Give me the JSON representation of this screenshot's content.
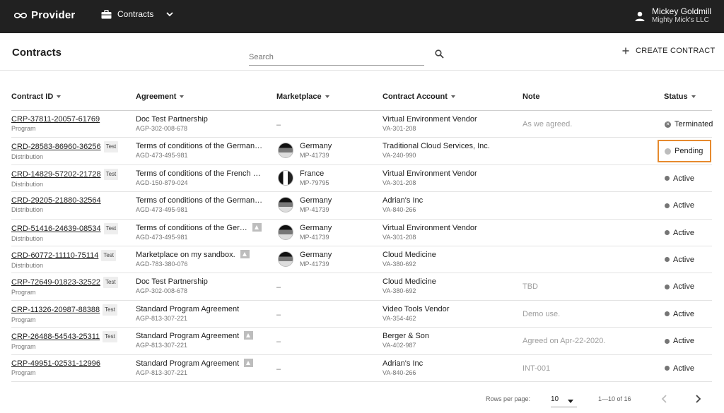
{
  "app": {
    "name": "Provider",
    "product": "Contracts"
  },
  "user": {
    "name": "Mickey Goldmill",
    "org": "Mighty Mick's LLC"
  },
  "page": {
    "title": "Contracts",
    "search_placeholder": "Search",
    "create_label": "CREATE CONTRACT"
  },
  "table": {
    "columns": {
      "contract_id": "Contract ID",
      "agreement": "Agreement",
      "marketplace": "Marketplace",
      "account": "Contract Account",
      "note": "Note",
      "status": "Status"
    },
    "rows": [
      {
        "id": "CRP-37811-20057-61769",
        "type": "Program",
        "test": "",
        "agreement": "Doc Test Partnership",
        "agreement_id": "AGP-302-008-678",
        "warn": false,
        "marketplace": "",
        "marketplace_id": "",
        "flag": "",
        "empty": "–",
        "account": "Virtual Environment Vendor",
        "account_id": "VA-301-208",
        "note": "As we agreed.",
        "status": "Terminated",
        "status_icon": "terminated-icon"
      },
      {
        "id": "CRD-28583-86960-36256",
        "type": "Distribution",
        "test": "Test",
        "agreement": "Terms of conditions of the German…",
        "agreement_id": "AGD-473-495-981",
        "warn": false,
        "marketplace": "Germany",
        "marketplace_id": "MP-41739",
        "flag": "de",
        "empty": "",
        "account": "Traditional Cloud Services, Inc.",
        "account_id": "VA-240-990",
        "note": "",
        "status": "Pending",
        "status_icon": "pending-icon",
        "highlight": true
      },
      {
        "id": "CRD-14829-57202-21728",
        "type": "Distribution",
        "test": "Test",
        "agreement": "Terms of conditions of the French …",
        "agreement_id": "AGD-150-879-024",
        "warn": false,
        "marketplace": "France",
        "marketplace_id": "MP-79795",
        "flag": "fr",
        "empty": "",
        "account": "Virtual Environment Vendor",
        "account_id": "VA-301-208",
        "note": "",
        "status": "Active",
        "status_icon": "active-icon"
      },
      {
        "id": "CRD-29205-21880-32564",
        "type": "Distribution",
        "test": "",
        "agreement": "Terms of conditions of the German…",
        "agreement_id": "AGD-473-495-981",
        "warn": false,
        "marketplace": "Germany",
        "marketplace_id": "MP-41739",
        "flag": "de",
        "empty": "",
        "account": "Adrian's Inc",
        "account_id": "VA-840-266",
        "note": "",
        "status": "Active",
        "status_icon": "active-icon"
      },
      {
        "id": "CRD-51416-24639-08534",
        "type": "Distribution",
        "test": "Test",
        "agreement": "Terms of conditions of the Ger…",
        "agreement_id": "AGD-473-495-981",
        "warn": true,
        "marketplace": "Germany",
        "marketplace_id": "MP-41739",
        "flag": "de",
        "empty": "",
        "account": "Virtual Environment Vendor",
        "account_id": "VA-301-208",
        "note": "",
        "status": "Active",
        "status_icon": "active-icon"
      },
      {
        "id": "CRD-60772-11110-75114",
        "type": "Distribution",
        "test": "Test",
        "agreement": "Marketplace on my sandbox.",
        "agreement_id": "AGD-783-380-076",
        "warn": true,
        "marketplace": "Germany",
        "marketplace_id": "MP-41739",
        "flag": "de",
        "empty": "",
        "account": "Cloud Medicine",
        "account_id": "VA-380-692",
        "note": "",
        "status": "Active",
        "status_icon": "active-icon"
      },
      {
        "id": "CRP-72649-01823-32522",
        "type": "Program",
        "test": "Test",
        "agreement": "Doc Test Partnership",
        "agreement_id": "AGP-302-008-678",
        "warn": false,
        "marketplace": "",
        "marketplace_id": "",
        "flag": "",
        "empty": "–",
        "account": "Cloud Medicine",
        "account_id": "VA-380-692",
        "note": "TBD",
        "status": "Active",
        "status_icon": "active-icon"
      },
      {
        "id": "CRP-11326-20987-88388",
        "type": "Program",
        "test": "Test",
        "agreement": "Standard Program Agreement",
        "agreement_id": "AGP-813-307-221",
        "warn": false,
        "marketplace": "",
        "marketplace_id": "",
        "flag": "",
        "empty": "–",
        "account": "Video Tools Vendor",
        "account_id": "VA-354-462",
        "note": "Demo use.",
        "status": "Active",
        "status_icon": "active-icon"
      },
      {
        "id": "CRP-26488-54543-25311",
        "type": "Program",
        "test": "Test",
        "agreement": "Standard Program Agreement",
        "agreement_id": "AGP-813-307-221",
        "warn": true,
        "marketplace": "",
        "marketplace_id": "",
        "flag": "",
        "empty": "–",
        "account": "Berger & Son",
        "account_id": "VA-402-987",
        "note": "Agreed on Apr-22-2020.",
        "status": "Active",
        "status_icon": "active-icon"
      },
      {
        "id": "CRP-49951-02531-12996",
        "type": "Program",
        "test": "",
        "agreement": "Standard Program Agreement",
        "agreement_id": "AGP-813-307-221",
        "warn": true,
        "marketplace": "",
        "marketplace_id": "",
        "flag": "",
        "empty": "–",
        "account": "Adrian's Inc",
        "account_id": "VA-840-266",
        "note": "INT-001",
        "status": "Active",
        "status_icon": "active-icon"
      }
    ]
  },
  "pagination": {
    "rows_per_page_label": "Rows per page:",
    "rows_per_page": "10",
    "range": "1—10 of 16"
  },
  "colors": {
    "topbar": "#212121",
    "highlight": "#e68a2e",
    "status_dot": "#757575"
  }
}
